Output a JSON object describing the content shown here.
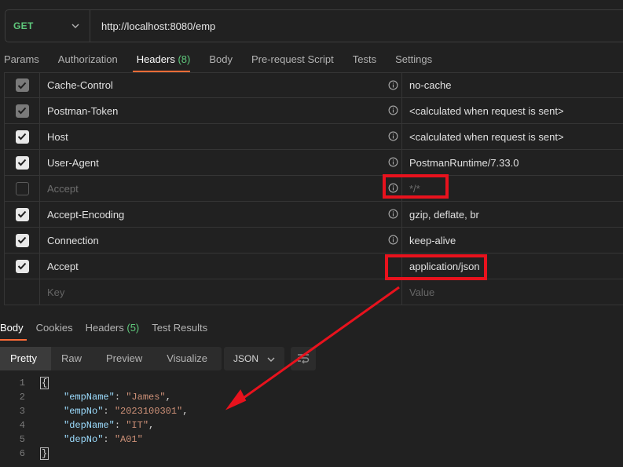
{
  "request": {
    "method": "GET",
    "url": "http://localhost:8080/emp"
  },
  "request_tabs": [
    {
      "label": "Params"
    },
    {
      "label": "Authorization"
    },
    {
      "label": "Headers",
      "count": "(8)"
    },
    {
      "label": "Body"
    },
    {
      "label": "Pre-request Script"
    },
    {
      "label": "Tests"
    },
    {
      "label": "Settings"
    }
  ],
  "headers": [
    {
      "key": "Cache-Control",
      "value": "no-cache",
      "checked": "dim"
    },
    {
      "key": "Postman-Token",
      "value": "<calculated when request is sent>",
      "checked": "dim"
    },
    {
      "key": "Host",
      "value": "<calculated when request is sent>",
      "checked": "on"
    },
    {
      "key": "User-Agent",
      "value": "PostmanRuntime/7.33.0",
      "checked": "on"
    },
    {
      "key": "Accept",
      "value": "*/*",
      "checked": "off"
    },
    {
      "key": "Accept-Encoding",
      "value": "gzip, deflate, br",
      "checked": "on"
    },
    {
      "key": "Connection",
      "value": "keep-alive",
      "checked": "on"
    },
    {
      "key": "Accept",
      "value": "application/json",
      "checked": "on"
    }
  ],
  "new_row": {
    "key_placeholder": "Key",
    "value_placeholder": "Value"
  },
  "response_tabs": [
    {
      "label": "Body"
    },
    {
      "label": "Cookies"
    },
    {
      "label": "Headers",
      "count": "(5)"
    },
    {
      "label": "Test Results"
    }
  ],
  "view_modes": [
    "Pretty",
    "Raw",
    "Preview",
    "Visualize"
  ],
  "format": "JSON",
  "response_body": {
    "open": "{",
    "close": "}",
    "fields": [
      {
        "key": "\"empName\"",
        "value": "\"James\"",
        "sep": ","
      },
      {
        "key": "\"empNo\"",
        "value": "\"2023100301\"",
        "sep": ","
      },
      {
        "key": "\"depName\"",
        "value": "\"IT\"",
        "sep": ","
      },
      {
        "key": "\"depNo\"",
        "value": "\"A01\"",
        "sep": ""
      }
    ],
    "line_numbers": [
      "1",
      "2",
      "3",
      "4",
      "5",
      "6"
    ]
  },
  "colors": {
    "method_get": "#5fc97c",
    "accent_orange": "#ff6c37",
    "annotation_red": "#e8121d",
    "json_key": "#9cdcfe",
    "json_string": "#ce9178"
  }
}
